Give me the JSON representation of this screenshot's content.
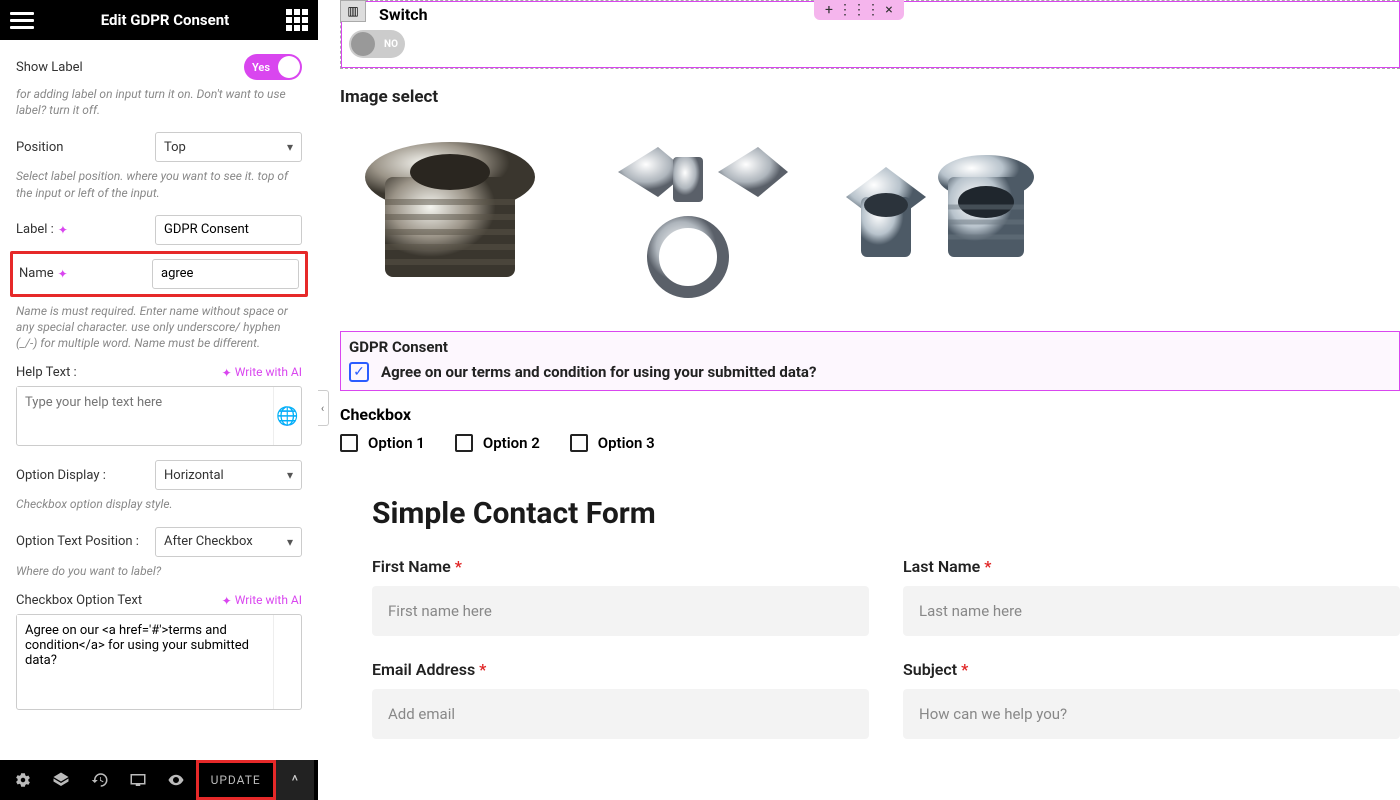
{
  "sidebar": {
    "title": "Edit GDPR Consent",
    "showLabel": {
      "label": "Show Label",
      "value": "Yes",
      "desc": "for adding label on input turn it on. Don't want to use label? turn it off."
    },
    "position": {
      "label": "Position",
      "value": "Top",
      "desc": "Select label position. where you want to see it. top of the input or left of the input."
    },
    "labelField": {
      "label": "Label :",
      "value": "GDPR Consent"
    },
    "nameField": {
      "label": "Name",
      "value": "agree",
      "desc": "Name is must required. Enter name without space or any special character. use only underscore/ hyphen (_/-) for multiple word. Name must be different."
    },
    "helpText": {
      "label": "Help Text :",
      "ai": "Write with AI",
      "placeholder": "Type your help text here"
    },
    "optionDisplay": {
      "label": "Option Display :",
      "value": "Horizontal",
      "desc": "Checkbox option display style."
    },
    "optionTextPos": {
      "label": "Option Text Position :",
      "value": "After Checkbox",
      "desc": "Where do you want to label?"
    },
    "checkboxOptionText": {
      "label": "Checkbox Option Text",
      "ai": "Write with AI",
      "value": "Agree on our <a href='#'>terms and condition</a> for using your submitted data?"
    },
    "update": "UPDATE"
  },
  "canvas": {
    "switch": {
      "label": "Switch",
      "value": "NO"
    },
    "imageSelect": "Image select",
    "gdpr": {
      "heading": "GDPR Consent",
      "text": "Agree on our terms and condition for using your submitted data?"
    },
    "checkbox": {
      "heading": "Checkbox",
      "options": [
        "Option 1",
        "Option 2",
        "Option 3"
      ]
    },
    "contact": {
      "heading": "Simple Contact Form",
      "fields": {
        "firstName": {
          "label": "First Name",
          "placeholder": "First name here"
        },
        "lastName": {
          "label": "Last Name",
          "placeholder": "Last name here"
        },
        "email": {
          "label": "Email Address",
          "placeholder": "Add email"
        },
        "subject": {
          "label": "Subject",
          "placeholder": "How can we help you?"
        }
      }
    }
  }
}
